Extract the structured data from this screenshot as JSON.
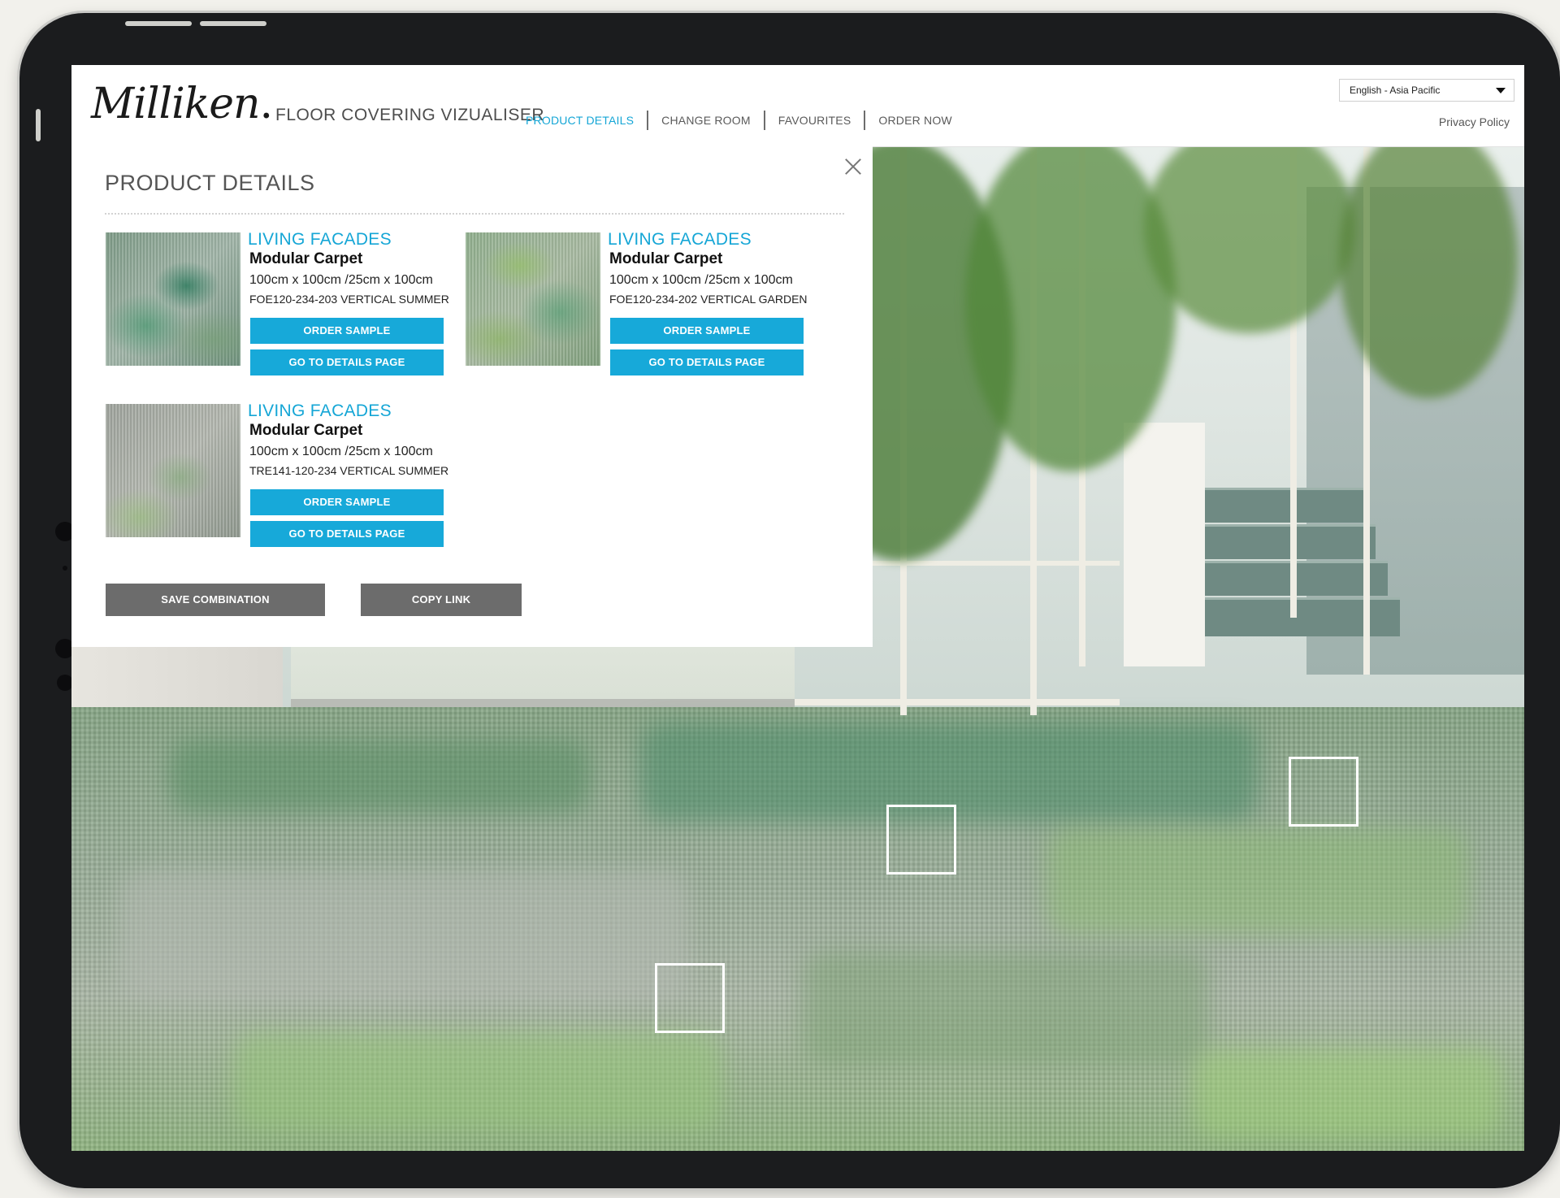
{
  "header": {
    "logo_text": "Milliken",
    "app_title": "FLOOR COVERING VIZUALISER",
    "nav": [
      {
        "label": "PRODUCT DETAILS",
        "active": true
      },
      {
        "label": "CHANGE ROOM",
        "active": false
      },
      {
        "label": "FAVOURITES",
        "active": false
      },
      {
        "label": "ORDER NOW",
        "active": false
      }
    ],
    "language_selected": "English - Asia Pacific",
    "privacy_label": "Privacy Policy"
  },
  "panel": {
    "title": "PRODUCT DETAILS",
    "products": [
      {
        "series": "LIVING FACADES",
        "type": "Modular Carpet",
        "size": "100cm x 100cm /25cm x 100cm",
        "code": "FOE120-234-203 VERTICAL SUMMER",
        "order_label": "ORDER SAMPLE",
        "details_label": "GO TO DETAILS PAGE"
      },
      {
        "series": "LIVING FACADES",
        "type": "Modular Carpet",
        "size": "100cm x 100cm /25cm x 100cm",
        "code": "FOE120-234-202 VERTICAL GARDEN",
        "order_label": "ORDER SAMPLE",
        "details_label": "GO TO DETAILS PAGE"
      },
      {
        "series": "LIVING FACADES",
        "type": "Modular Carpet",
        "size": "100cm x 100cm /25cm x 100cm",
        "code": "TRE141-120-234 VERTICAL SUMMER",
        "order_label": "ORDER SAMPLE",
        "details_label": "GO TO DETAILS PAGE"
      }
    ],
    "save_label": "SAVE COMBINATION",
    "copy_label": "COPY LINK"
  },
  "colors": {
    "accent": "#17a9d9",
    "button_grey": "#6c6c6c",
    "device_frame": "#1b1c1e"
  },
  "icons": {
    "close": "close-icon",
    "dropdown": "chevron-down-icon"
  }
}
